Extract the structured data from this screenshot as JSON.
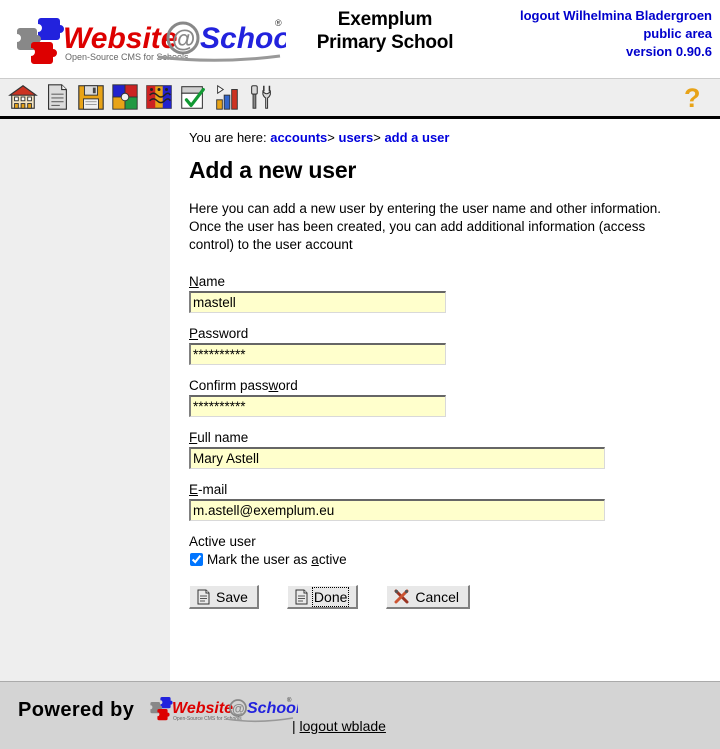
{
  "header": {
    "logo_alt": "Website@School - Open-Source CMS for Schools",
    "school_line1": "Exemplum",
    "school_line2": "Primary School",
    "logout_label": "logout Wilhelmina Bladergroen",
    "area_label": "public area",
    "version_label": "version 0.90.6"
  },
  "toolbar": {
    "icons": [
      {
        "name": "home-icon",
        "title": "Home"
      },
      {
        "name": "page-icon",
        "title": "Pages"
      },
      {
        "name": "save-disk-icon",
        "title": "File manager"
      },
      {
        "name": "modules-icon",
        "title": "Modules"
      },
      {
        "name": "users-icon",
        "title": "Accounts"
      },
      {
        "name": "approve-icon",
        "title": "Approve"
      },
      {
        "name": "statistics-icon",
        "title": "Statistics"
      },
      {
        "name": "tools-icon",
        "title": "Tools"
      }
    ],
    "help_label": "?"
  },
  "breadcrumb": {
    "prefix": "You are here:",
    "items": [
      {
        "label": "accounts",
        "link": true
      },
      {
        "label": "users",
        "link": true
      },
      {
        "label": "add a user",
        "link": true
      }
    ],
    "separator": ">"
  },
  "main": {
    "title": "Add a new user",
    "intro": "Here you can add a new user by entering the user name and other information. Once the user has been created, you can add additional information (access control) to the user account"
  },
  "form": {
    "name": {
      "label_accesskey": "N",
      "label_rest": "ame",
      "value": "mastell",
      "placeholder": ""
    },
    "password": {
      "label_accesskey": "P",
      "label_rest": "assword",
      "value": "**********",
      "placeholder": ""
    },
    "confirm": {
      "label_pre": "Confirm pass",
      "label_accesskey": "w",
      "label_rest": "ord",
      "value": "**********",
      "placeholder": ""
    },
    "fullname": {
      "label_accesskey": "F",
      "label_rest": "ull name",
      "value": "Mary Astell",
      "placeholder": ""
    },
    "email": {
      "label_accesskey": "E",
      "label_rest": "-mail",
      "value": "m.astell@exemplum.eu",
      "placeholder": ""
    },
    "active": {
      "group_label": "Active user",
      "checkbox_checked": true,
      "label_pre": "Mark the user as ",
      "label_accesskey": "a",
      "label_rest": "ctive"
    }
  },
  "buttons": {
    "save": {
      "label": "Save",
      "icon": "document-icon",
      "focused": false
    },
    "done": {
      "label": "Done",
      "icon": "document-icon",
      "focused": true
    },
    "cancel": {
      "label": "Cancel",
      "icon": "cross-tools-icon",
      "focused": false
    }
  },
  "footer": {
    "powered_by": "Powered by",
    "logo_alt": "Website@School",
    "separator": "|",
    "logout_link": "logout wblade"
  },
  "colors": {
    "link_blue": "#0000dd",
    "header_blue": "#0000cc",
    "field_bg": "#ffffcc",
    "sidebar_bg": "#eeeeee",
    "toolbar_bg": "#eeeeee",
    "footer_bg": "#d4d4d4",
    "help_yellow": "#e8a317"
  }
}
